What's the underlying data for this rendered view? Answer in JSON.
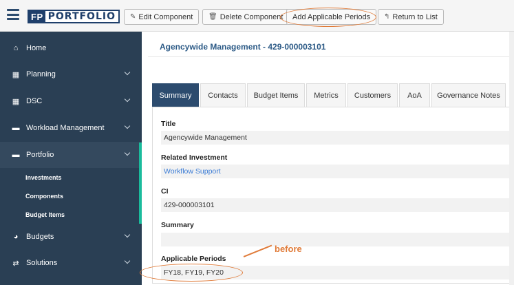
{
  "app": {
    "logo_fp": "FP",
    "logo_text": "PORTFOLIO"
  },
  "toolbar": {
    "edit_label": "Edit Component",
    "delete_label": "Delete Component",
    "add_periods_label": "Add Applicable Periods",
    "return_label": "Return to List"
  },
  "sidebar": {
    "items": [
      {
        "label": "Home",
        "icon": "home-icon"
      },
      {
        "label": "Planning",
        "icon": "table-icon"
      },
      {
        "label": "DSC",
        "icon": "table-icon"
      },
      {
        "label": "Workload Management",
        "icon": "folder-icon"
      },
      {
        "label": "Portfolio",
        "icon": "folder-icon"
      },
      {
        "label": "Budgets",
        "icon": "pie-chart-icon"
      },
      {
        "label": "Solutions",
        "icon": "exchange-icon"
      }
    ],
    "sub_items": [
      {
        "label": "Investments"
      },
      {
        "label": "Components"
      },
      {
        "label": "Budget Items"
      }
    ]
  },
  "main": {
    "title": "Agencywide Management - 429-000003101",
    "tabs": [
      {
        "label": "Summary"
      },
      {
        "label": "Contacts"
      },
      {
        "label": "Budget Items"
      },
      {
        "label": "Metrics"
      },
      {
        "label": "Customers"
      },
      {
        "label": "AoA"
      },
      {
        "label": "Governance Notes"
      }
    ],
    "fields": {
      "title_label": "Title",
      "title_value": "Agencywide Management",
      "investment_label": "Related Investment",
      "investment_value": "Workflow Support",
      "ci_label": "CI",
      "ci_value": "429-000003101",
      "summary_label": "Summary",
      "summary_value": "",
      "periods_label": "Applicable Periods",
      "periods_value": "FY18, FY19, FY20"
    }
  },
  "annotation": {
    "text": "before",
    "color": "#e07b39"
  },
  "colors": {
    "sidebar_bg": "#2a3f54",
    "accent": "#1abb9c",
    "tab_active": "#2c4b6e",
    "title_blue": "#2c5a86",
    "link": "#3a7bd5"
  }
}
